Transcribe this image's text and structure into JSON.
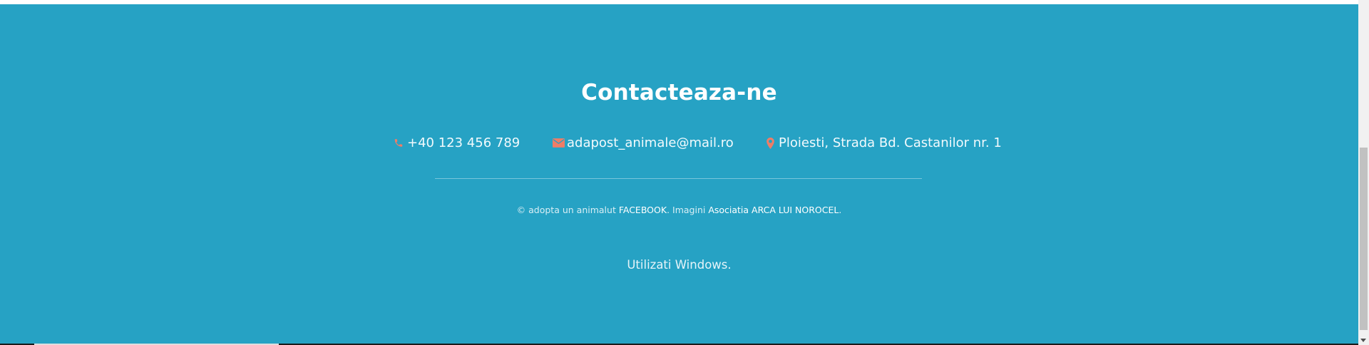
{
  "footer": {
    "background_color": "#26a2c4",
    "accent_color": "#ef7d67",
    "title": "Contacteaza-ne",
    "contacts": {
      "phone": {
        "icon": "phone-icon",
        "text": "+40 123 456 789"
      },
      "email": {
        "icon": "envelope-icon",
        "text": "adapost_animale@mail.ro"
      },
      "address": {
        "icon": "map-marker-icon",
        "text": "Ploiesti, Strada Bd. Castanilor nr. 1"
      }
    },
    "copyright": {
      "prefix": "© adopta un animalut ",
      "facebook_link": "FACEBOOK",
      "middle": ". Imagini ",
      "images_link": "Asociatia ARCA LUI NOROCEL",
      "suffix": "."
    },
    "windows_note": "Utilizati Windows."
  }
}
